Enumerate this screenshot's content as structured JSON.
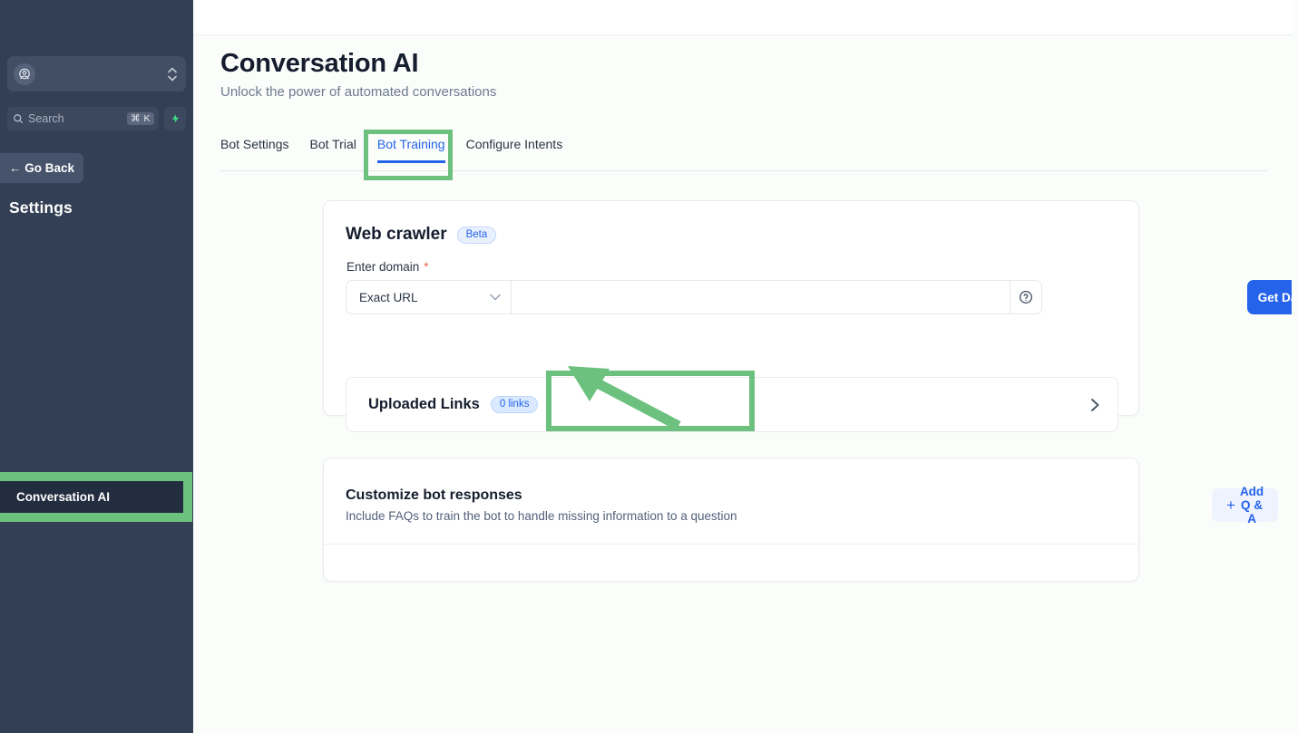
{
  "sidebar": {
    "org_switcher": {
      "icon": "user-pin-icon",
      "value": ""
    },
    "search": {
      "placeholder": "Search",
      "value": "",
      "shortcut": "⌘ K",
      "icon": "search-icon",
      "bolt_icon": "bolt-icon"
    },
    "go_back_label": "← Go Back",
    "section_title": "Settings",
    "active_item": "Conversation AI"
  },
  "header": {
    "title": "Conversation AI",
    "subtitle": "Unlock the power of automated conversations"
  },
  "tabs": [
    {
      "label": "Bot Settings",
      "active": false
    },
    {
      "label": "Bot Trial",
      "active": false
    },
    {
      "label": "Bot Training",
      "active": true
    },
    {
      "label": "Configure Intents",
      "active": false
    }
  ],
  "web_crawler": {
    "title": "Web crawler",
    "badge": "Beta",
    "field_label": "Enter domain",
    "required_mark": "*",
    "select_value": "Exact URL",
    "domain_value": "",
    "domain_placeholder": "",
    "help_icon": "question-circle-icon",
    "get_data_label": "Get Data",
    "uploaded_links": {
      "title": "Uploaded Links",
      "count_badge": "0 links",
      "chevron_icon": "chevron-right-icon"
    }
  },
  "customize_responses": {
    "title": "Customize bot responses",
    "subtitle": "Include FAQs to train the bot to handle missing information to a question",
    "add_button_label": "Add Q & A",
    "add_button_icon": "plus-icon"
  },
  "colors": {
    "accent_blue": "#2563eb",
    "highlight_green": "#6cc17f",
    "sidebar_bg": "#333f54",
    "required_red": "#e8604c"
  }
}
